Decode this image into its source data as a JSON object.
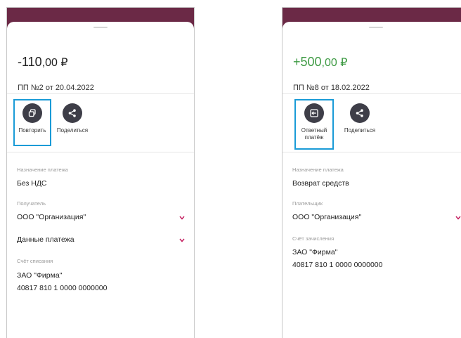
{
  "left_screen": {
    "amount_main": "-110",
    "amount_fraction": ",00 ₽",
    "subtitle": "ПП №2 от 20.04.2022",
    "actions": [
      {
        "label": "Повторить",
        "icon": "copy-icon"
      },
      {
        "label": "Поделиться",
        "icon": "share-icon"
      }
    ],
    "purpose_caption": "Назначение платежа",
    "purpose_value": "Без НДС",
    "recipient_caption": "Получатель",
    "recipient_value": "ООО \"Организация\"",
    "payment_data_label": "Данные платежа",
    "debit_account_caption": "Счёт списания",
    "debit_account_name": "ЗАО \"Фирма\"",
    "debit_account_number": "40817 810 1 0000 0000000"
  },
  "right_screen": {
    "amount_main": "+500",
    "amount_fraction": ",00 ₽",
    "subtitle": "ПП №8 от 18.02.2022",
    "actions": [
      {
        "label_line1": "Ответный",
        "label_line2": "платёж",
        "icon": "reply-payment-icon"
      },
      {
        "label": "Поделиться",
        "icon": "share-icon"
      }
    ],
    "purpose_caption": "Назначение платежа",
    "purpose_value": "Возврат средств",
    "payer_caption": "Плательщик",
    "payer_value": "ООО \"Организация\"",
    "credit_account_caption": "Счёт зачисления",
    "credit_account_name": "ЗАО \"Фирма\"",
    "credit_account_number": "40817 810 1 0000 0000000"
  },
  "colors": {
    "header": "#6b2946",
    "positive_amount": "#3d9a43",
    "highlight": "#1a9bd7",
    "icon_circle": "#3e3e48",
    "chevron": "#c2185b"
  }
}
